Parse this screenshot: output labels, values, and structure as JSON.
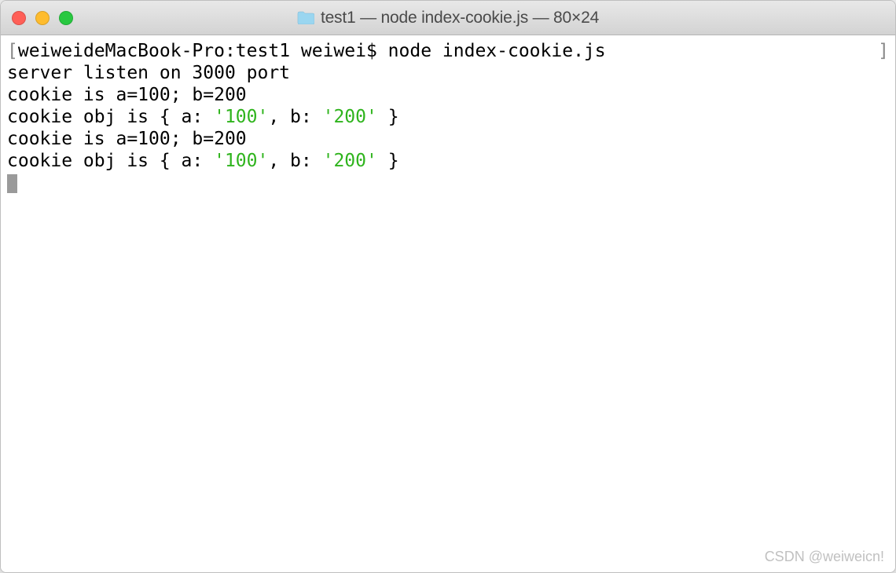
{
  "window": {
    "title": "test1 — node index-cookie.js — 80×24"
  },
  "terminal": {
    "prompt": {
      "left_bracket": "[",
      "host_path": "weiweideMacBook-Pro:test1 weiwei$ ",
      "command": "node index-cookie.js",
      "right_bracket": "]"
    },
    "lines": [
      {
        "segments": [
          {
            "text": "server listen on 3000 port",
            "class": ""
          }
        ]
      },
      {
        "segments": [
          {
            "text": "cookie is a=100; b=200",
            "class": ""
          }
        ]
      },
      {
        "segments": [
          {
            "text": "cookie obj is { a: ",
            "class": ""
          },
          {
            "text": "'100'",
            "class": "green"
          },
          {
            "text": ", b: ",
            "class": ""
          },
          {
            "text": "'200'",
            "class": "green"
          },
          {
            "text": " }",
            "class": ""
          }
        ]
      },
      {
        "segments": [
          {
            "text": "cookie is a=100; b=200",
            "class": ""
          }
        ]
      },
      {
        "segments": [
          {
            "text": "cookie obj is { a: ",
            "class": ""
          },
          {
            "text": "'100'",
            "class": "green"
          },
          {
            "text": ", b: ",
            "class": ""
          },
          {
            "text": "'200'",
            "class": "green"
          },
          {
            "text": " }",
            "class": ""
          }
        ]
      }
    ]
  },
  "watermark": "CSDN @weiweicn!"
}
